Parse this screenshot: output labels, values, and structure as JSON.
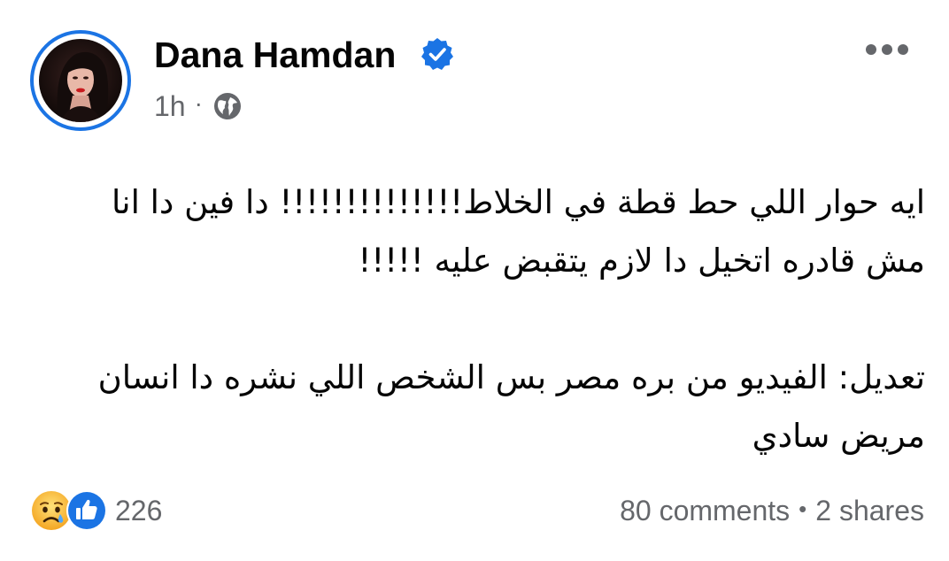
{
  "post": {
    "author": {
      "name": "Dana Hamdan",
      "verified": true,
      "avatar_ring_color": "#1b74e4"
    },
    "meta": {
      "time": "1h",
      "separator": "·",
      "privacy_icon": "globe-icon"
    },
    "menu_icon": "more-horizontal-icon",
    "text": {
      "line1": "ايه حوار اللي حط قطة في الخلاط!!!!!!!!!!!!!! دا فين دا انا مش قادره اتخيل دا لازم يتقبض عليه !!!!!",
      "line2": "تعديل: الفيديو من بره مصر بس الشخص اللي نشره دا انسان مريض سادي"
    },
    "reactions": {
      "icons": [
        "sad-reaction-icon",
        "like-reaction-icon"
      ],
      "count": "226"
    },
    "engagement": {
      "comments": "80 comments",
      "separator": "•",
      "shares": "2 shares"
    }
  },
  "colors": {
    "accent": "#1b74e4",
    "secondary_text": "#65676b",
    "primary_text": "#050505"
  }
}
